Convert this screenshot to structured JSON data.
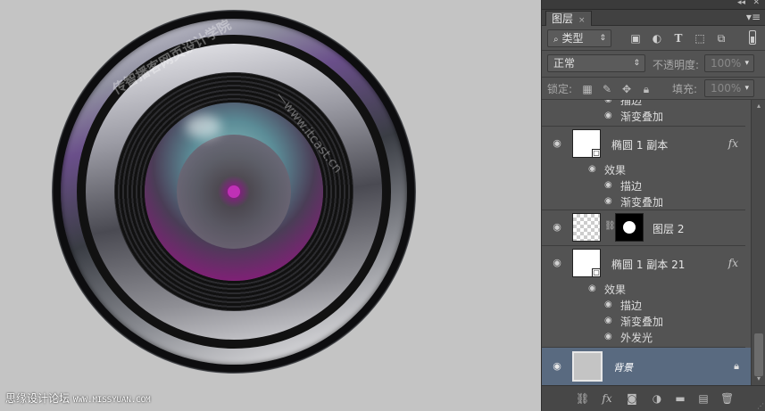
{
  "canvas": {
    "watermark_text": "传智播客网页设计学院",
    "watermark_url": "www.itcast.cn",
    "credit_text": "思缘设计论坛",
    "credit_url": "WWW.MISSYUAN.COM"
  },
  "panel": {
    "tab_label": "图层",
    "filter": {
      "label": "类型"
    },
    "blend_mode": "正常",
    "opacity_label": "不透明度:",
    "opacity_value": "100%",
    "lock_label": "锁定:",
    "fill_label": "填充:",
    "fill_value": "100%"
  },
  "layers": {
    "partial_top": {
      "effect1": "描边",
      "effect2": "渐变叠加"
    },
    "layer1": {
      "name": "椭圆 1 副本",
      "fx": "fx",
      "effects_label": "效果",
      "effects": [
        "描边",
        "渐变叠加"
      ]
    },
    "layer2": {
      "name": "图层 2"
    },
    "layer3": {
      "name": "椭圆 1 副本 21",
      "fx": "fx",
      "effects_label": "效果",
      "effects": [
        "描边",
        "渐变叠加",
        "外发光"
      ]
    },
    "background": {
      "name": "背景"
    }
  },
  "icons": {
    "eye": "eye-icon",
    "lock": "lock-icon",
    "link": "link-icon",
    "fx": "fx-icon",
    "mask": "mask-icon",
    "adjust": "adjustment-icon",
    "folder": "folder-icon",
    "new": "new-layer-icon",
    "trash": "trash-icon"
  },
  "colors": {
    "panel_bg": "#535353",
    "selected_row": "#596a80",
    "canvas_bg": "#c4c4c4"
  }
}
